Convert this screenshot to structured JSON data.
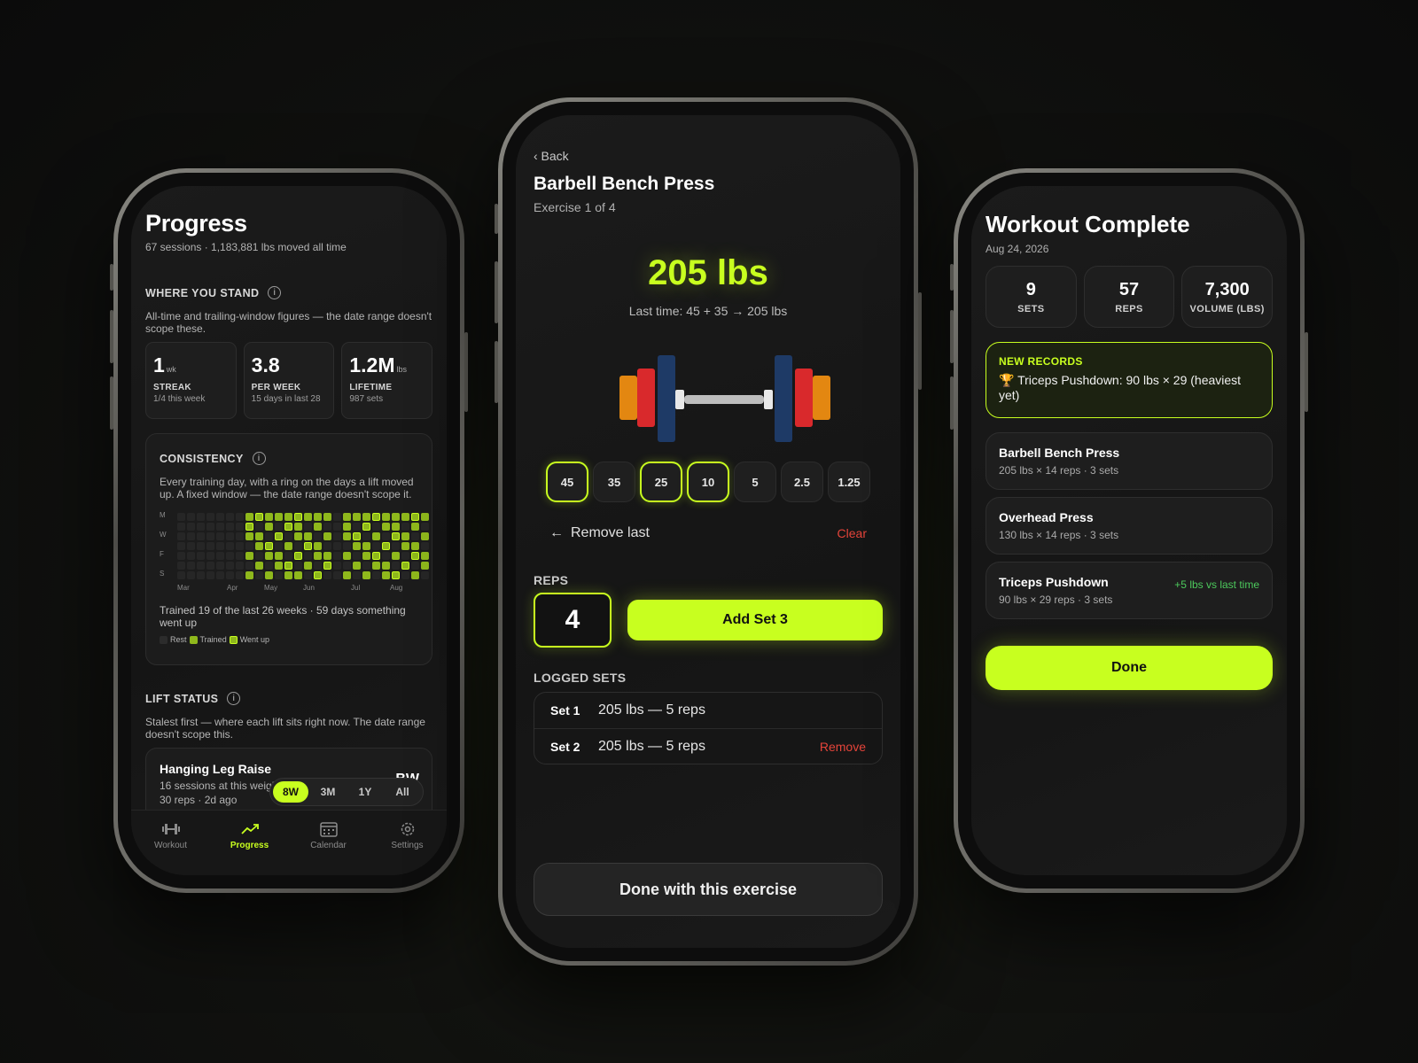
{
  "colors": {
    "accent": "#c8ff1f",
    "danger": "#e5443a",
    "positive": "#4cc95c",
    "background": "#0b0b0b"
  },
  "progress": {
    "title": "Progress",
    "subtitle": "67 sessions · 1,183,881 lbs moved all time",
    "where": {
      "heading": "WHERE YOU STAND",
      "info": "i",
      "desc": "All-time and trailing-window figures — the date range doesn't scope these.",
      "stats": [
        {
          "value": "1",
          "unit": "wk",
          "label": "STREAK",
          "sub": "1/4 this week"
        },
        {
          "value": "3.8",
          "unit": "",
          "label": "PER WEEK",
          "sub": "15 days in last 28"
        },
        {
          "value": "1.2M",
          "unit": "lbs",
          "label": "LIFETIME",
          "sub": "987 sets"
        }
      ]
    },
    "consistency": {
      "heading": "CONSISTENCY",
      "info": "i",
      "desc": "Every training day, with a ring on the days a lift moved up. A fixed window — the date range doesn't scope it.",
      "day_labels": [
        "M",
        "W",
        "F",
        "S"
      ],
      "month_labels": [
        "Mar",
        "Apr",
        "May",
        "Jun",
        "Jul",
        "Aug"
      ],
      "weeks": 26,
      "trained_weeks": [
        7,
        8,
        9,
        10,
        11,
        12,
        13,
        14,
        15,
        17,
        18,
        19,
        20,
        21,
        22,
        23,
        24,
        25
      ],
      "summary": "Trained 19 of the last 26 weeks · 59 days something went up",
      "legend": {
        "rest": "Rest",
        "trained": "Trained",
        "went_up": "Went up"
      }
    },
    "lift": {
      "heading": "LIFT STATUS",
      "info": "i",
      "desc": "Stalest first — where each lift sits right now. The date range doesn't scope this.",
      "item": {
        "name": "Hanging Leg Raise",
        "line1": "16 sessions at this weight",
        "line2": "30 reps · 2d ago",
        "badge": "BW"
      }
    },
    "range": {
      "options": [
        "8W",
        "3M",
        "1Y",
        "All"
      ],
      "selected": "8W"
    },
    "tabs": [
      {
        "label": "Workout",
        "icon": "dumbbell-icon"
      },
      {
        "label": "Progress",
        "icon": "trend-up-icon"
      },
      {
        "label": "Calendar",
        "icon": "calendar-icon"
      },
      {
        "label": "Settings",
        "icon": "gear-icon"
      }
    ],
    "active_tab": "Progress"
  },
  "exercise": {
    "back": "‹ Back",
    "title": "Barbell Bench Press",
    "subtitle": "Exercise 1 of 4",
    "weight": "205 lbs",
    "last_time": "Last time: 45 + 35 → 205 lbs",
    "plates": [
      {
        "label": "45",
        "selected": true
      },
      {
        "label": "35",
        "selected": false
      },
      {
        "label": "25",
        "selected": true
      },
      {
        "label": "10",
        "selected": true
      },
      {
        "label": "5",
        "selected": false
      },
      {
        "label": "2.5",
        "selected": false
      },
      {
        "label": "1.25",
        "selected": false
      }
    ],
    "remove_last": "Remove last",
    "clear": "Clear",
    "reps_label": "REPS",
    "reps": "4",
    "add_set": "Add Set 3",
    "logged_label": "LOGGED SETS",
    "sets": [
      {
        "label": "Set 1",
        "value": "205 lbs — 5 reps",
        "action": ""
      },
      {
        "label": "Set 2",
        "value": "205 lbs — 5 reps",
        "action": "Remove"
      }
    ],
    "done": "Done with this exercise"
  },
  "complete": {
    "title": "Workout Complete",
    "date": "Aug 24, 2026",
    "summary": [
      {
        "value": "9",
        "label": "SETS"
      },
      {
        "value": "57",
        "label": "REPS"
      },
      {
        "value": "7,300",
        "label": "VOLUME (LBS)"
      }
    ],
    "records": {
      "label": "NEW RECORDS",
      "text": "🏆 Triceps Pushdown: 90 lbs × 29 (heaviest yet)"
    },
    "exercises": [
      {
        "name": "Barbell Bench Press",
        "detail": "205 lbs × 14 reps · 3 sets",
        "badge": ""
      },
      {
        "name": "Overhead Press",
        "detail": "130 lbs × 14 reps · 3 sets",
        "badge": ""
      },
      {
        "name": "Triceps Pushdown",
        "detail": "90 lbs × 29 reps · 3 sets",
        "badge": "+5 lbs vs last time"
      }
    ],
    "done": "Done"
  }
}
